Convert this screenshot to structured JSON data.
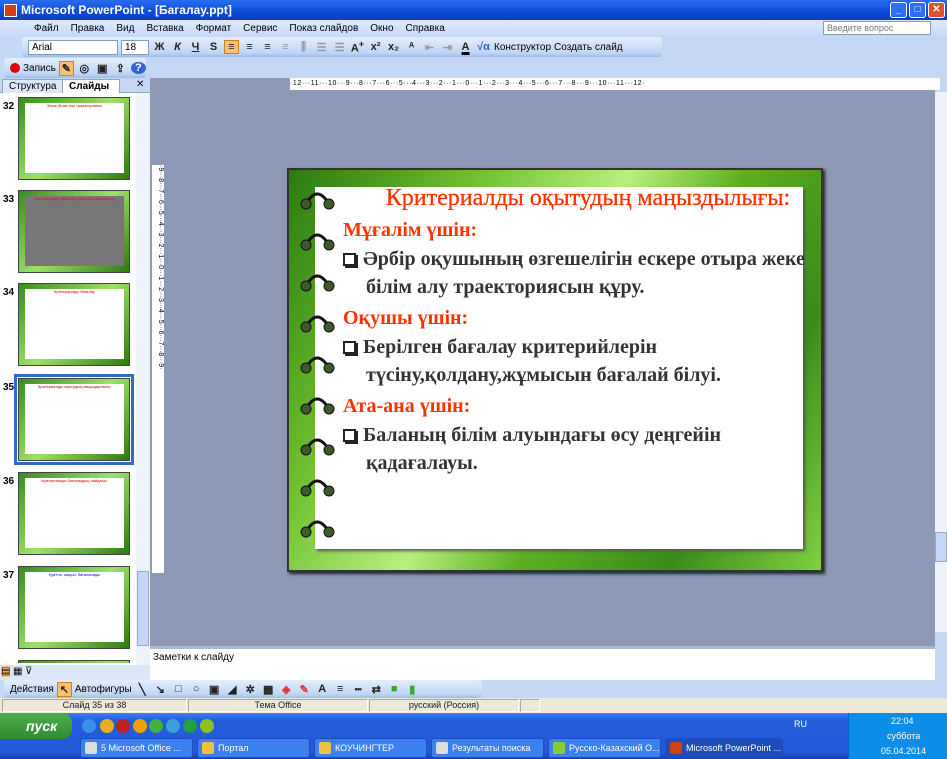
{
  "window": {
    "title": "Microsoft PowerPoint - [Багалау.ppt]",
    "min": "_",
    "max": "□",
    "close": "✕"
  },
  "menu": [
    "Файл",
    "Правка",
    "Вид",
    "Вставка",
    "Формат",
    "Сервис",
    "Показ слайдов",
    "Окно",
    "Справка"
  ],
  "help_placeholder": "Введите вопрос",
  "format_toolbar": {
    "font": "Arial",
    "size": "18",
    "bold": "Ж",
    "italic": "К",
    "underline": "Ч",
    "shadow": "S",
    "designer": "Конструктор",
    "new_slide": "Создать слайд"
  },
  "record_toolbar": {
    "record": "Запись"
  },
  "pane_tabs": {
    "outline": "Структура",
    "slides": "Слайды",
    "close": "✕"
  },
  "thumbnails": [
    {
      "num": "32",
      "title": "Жеке білім алу траекториясы"
    },
    {
      "num": "33",
      "title": "Критериалды бағалау бойынша нәтижелер"
    },
    {
      "num": "34",
      "title": "Критериалды бағалау"
    },
    {
      "num": "35",
      "title": "Критериалды оқытудың маңыздылығы:"
    },
    {
      "num": "36",
      "title": "Критериалды бағалаудың пайдасы:"
    },
    {
      "num": "37",
      "title": "Қуатты, жақсы, бағаланады"
    }
  ],
  "ruler": {
    "horizontal": "·12···11···10···9···8···7···6···5···4···3···2···1···0···1···2···3···4···5···6···7···8···9···10···11···12·",
    "vertical": "·9···8···7···6···5···4···3···2···1···0···1···2···3···4···5···6···7···8···9·"
  },
  "slide": {
    "title": "Критериалды   оқытудың маңыздылығы:",
    "sections": [
      {
        "heading": "Мұғалім үшін:",
        "item": "Әрбір оқушының өзгешелігін ескере отыра жеке білім алу траекториясын құру."
      },
      {
        "heading": "Оқушы үшін:",
        "item": "Берілген бағалау критерийлерін түсіну,қолдану,жұмысын бағалай білуі."
      },
      {
        "heading": "Ата-ана үшін:",
        "item": "Баланың білім алуындағы өсу деңгейін қадағалауы."
      }
    ]
  },
  "notes_placeholder": "Заметки к слайду",
  "draw_toolbar": {
    "actions": "Действия",
    "autoshapes": "Автофигуры"
  },
  "status": {
    "slide": "Слайд 35 из 38",
    "theme": "Тема Office",
    "lang": "русский (Россия)"
  },
  "taskbar": {
    "start": "пуск",
    "tasks": [
      "5 Microsoft Office ...",
      "Портал",
      "КОУЧИНГТЕР",
      "Результаты поиска",
      "Русско-Казахский О...",
      "Microsoft PowerPoint ..."
    ],
    "lang": "RU",
    "time": "22:04",
    "day": "суббота",
    "date": "05.04.2014"
  }
}
